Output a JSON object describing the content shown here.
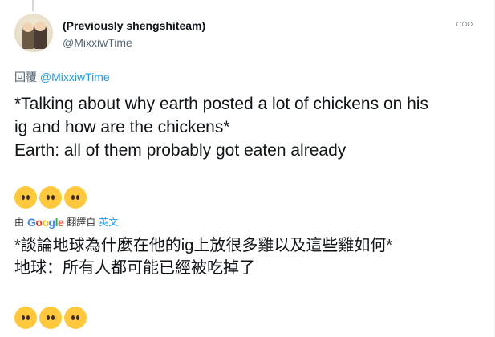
{
  "author": {
    "name": "(Previously shengshiteam)",
    "handle": "@MixxiwTime"
  },
  "reply": {
    "prefix": "回覆",
    "mention": "@MixxiwTime"
  },
  "tweet": {
    "lines": [
      "*Talking about why earth posted a lot of chickens on his",
      "ig and how are the chickens*",
      "Earth: all of them probably got eaten already"
    ]
  },
  "translation_bar": {
    "by": "由",
    "google": [
      "G",
      "o",
      "o",
      "g",
      "l",
      "e"
    ],
    "translated_from": "翻譯自",
    "language": "英文"
  },
  "translated_text": {
    "lines": [
      "*談論地球為什麼在他的ig上放很多雞以及這些雞如何*",
      "地球：所有人都可能已經被吃掉了"
    ]
  },
  "emoji_icons": [
    "face-without-mouth-emoji",
    "face-without-mouth-emoji",
    "face-without-mouth-emoji"
  ],
  "colors": {
    "link": "#1d9bf0",
    "secondary_text": "#536471",
    "emoji": "#ffc83d"
  }
}
